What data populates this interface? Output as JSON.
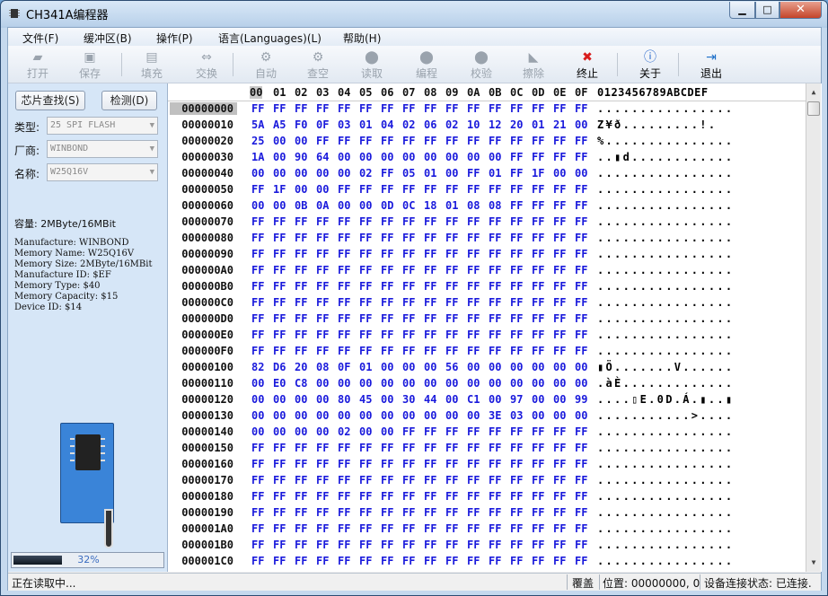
{
  "window": {
    "title": "CH341A编程器",
    "min": "▁",
    "max": "□",
    "close": "✕"
  },
  "menu": [
    "文件(F)",
    "缓冲区(B)",
    "操作(P)",
    "语言(Languages)(L)",
    "帮助(H)"
  ],
  "toolbar": [
    {
      "label": "打开",
      "icon": "folder-open-icon",
      "glyph": "▰",
      "enabled": false
    },
    {
      "label": "保存",
      "icon": "floppy-save-icon",
      "glyph": "▣",
      "enabled": false
    },
    {
      "label": "填充",
      "icon": "fill-icon",
      "glyph": "▤",
      "enabled": false
    },
    {
      "label": "交换",
      "icon": "swap-arrows-icon",
      "glyph": "⇔",
      "enabled": false
    },
    {
      "label": "自动",
      "icon": "auto-gear-icon",
      "glyph": "⚙",
      "enabled": false
    },
    {
      "label": "查空",
      "icon": "blank-check-icon",
      "glyph": "⚙",
      "enabled": false
    },
    {
      "label": "读取",
      "icon": "read-chip-icon",
      "glyph": "⬤",
      "enabled": false
    },
    {
      "label": "编程",
      "icon": "program-chip-icon",
      "glyph": "⬤",
      "enabled": false
    },
    {
      "label": "校验",
      "icon": "verify-chip-icon",
      "glyph": "⬤",
      "enabled": false
    },
    {
      "label": "擦除",
      "icon": "erase-icon",
      "glyph": "◣",
      "enabled": false
    },
    {
      "label": "终止",
      "icon": "stop-icon",
      "glyph": "✖",
      "enabled": true
    },
    {
      "label": "关于",
      "icon": "info-icon",
      "glyph": "ⓘ",
      "enabled": true
    },
    {
      "label": "退出",
      "icon": "exit-door-icon",
      "glyph": "⇥",
      "enabled": true
    }
  ],
  "panel": {
    "search_btn": "芯片查找(S)",
    "detect_btn": "检测(D)",
    "type_label": "类型:",
    "type_value": "25 SPI FLASH",
    "vendor_label": "厂商:",
    "vendor_value": "WINBOND",
    "name_label": "名称:",
    "name_value": "W25Q16V",
    "capacity": "容量: 2MByte/16MBit",
    "info_lines": [
      "Manufacture: WINBOND",
      "Memory Name: W25Q16V",
      "Memory Size: 2MByte/16MBit",
      "Manufacture ID: $EF",
      "Memory Type: $40",
      "Memory Capacity: $15",
      "Device ID: $14"
    ],
    "progress_text": "32%",
    "progress_value": 0.32
  },
  "hex": {
    "columns": [
      "00",
      "01",
      "02",
      "03",
      "04",
      "05",
      "06",
      "07",
      "08",
      "09",
      "0A",
      "0B",
      "0C",
      "0D",
      "0E",
      "0F"
    ],
    "ascii_header": "0123456789ABCDEF",
    "rows": [
      {
        "addr": "00000000",
        "bytes": [
          "FF",
          "FF",
          "FF",
          "FF",
          "FF",
          "FF",
          "FF",
          "FF",
          "FF",
          "FF",
          "FF",
          "FF",
          "FF",
          "FF",
          "FF",
          "FF"
        ],
        "ascii": "................"
      },
      {
        "addr": "00000010",
        "bytes": [
          "5A",
          "A5",
          "F0",
          "0F",
          "03",
          "01",
          "04",
          "02",
          "06",
          "02",
          "10",
          "12",
          "20",
          "01",
          "21",
          "00"
        ],
        "ascii": "Z¥ð.........!."
      },
      {
        "addr": "00000020",
        "bytes": [
          "25",
          "00",
          "00",
          "FF",
          "FF",
          "FF",
          "FF",
          "FF",
          "FF",
          "FF",
          "FF",
          "FF",
          "FF",
          "FF",
          "FF",
          "FF"
        ],
        "ascii": "%..............."
      },
      {
        "addr": "00000030",
        "bytes": [
          "1A",
          "00",
          "90",
          "64",
          "00",
          "00",
          "00",
          "00",
          "00",
          "00",
          "00",
          "00",
          "FF",
          "FF",
          "FF",
          "FF"
        ],
        "ascii": "..▮d............"
      },
      {
        "addr": "00000040",
        "bytes": [
          "00",
          "00",
          "00",
          "00",
          "00",
          "02",
          "FF",
          "05",
          "01",
          "00",
          "FF",
          "01",
          "FF",
          "1F",
          "00",
          "00"
        ],
        "ascii": "................"
      },
      {
        "addr": "00000050",
        "bytes": [
          "FF",
          "1F",
          "00",
          "00",
          "FF",
          "FF",
          "FF",
          "FF",
          "FF",
          "FF",
          "FF",
          "FF",
          "FF",
          "FF",
          "FF",
          "FF"
        ],
        "ascii": "................"
      },
      {
        "addr": "00000060",
        "bytes": [
          "00",
          "00",
          "0B",
          "0A",
          "00",
          "00",
          "0D",
          "0C",
          "18",
          "01",
          "08",
          "08",
          "FF",
          "FF",
          "FF",
          "FF"
        ],
        "ascii": "................"
      },
      {
        "addr": "00000070",
        "bytes": [
          "FF",
          "FF",
          "FF",
          "FF",
          "FF",
          "FF",
          "FF",
          "FF",
          "FF",
          "FF",
          "FF",
          "FF",
          "FF",
          "FF",
          "FF",
          "FF"
        ],
        "ascii": "................"
      },
      {
        "addr": "00000080",
        "bytes": [
          "FF",
          "FF",
          "FF",
          "FF",
          "FF",
          "FF",
          "FF",
          "FF",
          "FF",
          "FF",
          "FF",
          "FF",
          "FF",
          "FF",
          "FF",
          "FF"
        ],
        "ascii": "................"
      },
      {
        "addr": "00000090",
        "bytes": [
          "FF",
          "FF",
          "FF",
          "FF",
          "FF",
          "FF",
          "FF",
          "FF",
          "FF",
          "FF",
          "FF",
          "FF",
          "FF",
          "FF",
          "FF",
          "FF"
        ],
        "ascii": "................"
      },
      {
        "addr": "000000A0",
        "bytes": [
          "FF",
          "FF",
          "FF",
          "FF",
          "FF",
          "FF",
          "FF",
          "FF",
          "FF",
          "FF",
          "FF",
          "FF",
          "FF",
          "FF",
          "FF",
          "FF"
        ],
        "ascii": "................"
      },
      {
        "addr": "000000B0",
        "bytes": [
          "FF",
          "FF",
          "FF",
          "FF",
          "FF",
          "FF",
          "FF",
          "FF",
          "FF",
          "FF",
          "FF",
          "FF",
          "FF",
          "FF",
          "FF",
          "FF"
        ],
        "ascii": "................"
      },
      {
        "addr": "000000C0",
        "bytes": [
          "FF",
          "FF",
          "FF",
          "FF",
          "FF",
          "FF",
          "FF",
          "FF",
          "FF",
          "FF",
          "FF",
          "FF",
          "FF",
          "FF",
          "FF",
          "FF"
        ],
        "ascii": "................"
      },
      {
        "addr": "000000D0",
        "bytes": [
          "FF",
          "FF",
          "FF",
          "FF",
          "FF",
          "FF",
          "FF",
          "FF",
          "FF",
          "FF",
          "FF",
          "FF",
          "FF",
          "FF",
          "FF",
          "FF"
        ],
        "ascii": "................"
      },
      {
        "addr": "000000E0",
        "bytes": [
          "FF",
          "FF",
          "FF",
          "FF",
          "FF",
          "FF",
          "FF",
          "FF",
          "FF",
          "FF",
          "FF",
          "FF",
          "FF",
          "FF",
          "FF",
          "FF"
        ],
        "ascii": "................"
      },
      {
        "addr": "000000F0",
        "bytes": [
          "FF",
          "FF",
          "FF",
          "FF",
          "FF",
          "FF",
          "FF",
          "FF",
          "FF",
          "FF",
          "FF",
          "FF",
          "FF",
          "FF",
          "FF",
          "FF"
        ],
        "ascii": "................"
      },
      {
        "addr": "00000100",
        "bytes": [
          "82",
          "D6",
          "20",
          "08",
          "0F",
          "01",
          "00",
          "00",
          "00",
          "56",
          "00",
          "00",
          "00",
          "00",
          "00",
          "00"
        ],
        "ascii": "▮Ö.......V......"
      },
      {
        "addr": "00000110",
        "bytes": [
          "00",
          "E0",
          "C8",
          "00",
          "00",
          "00",
          "00",
          "00",
          "00",
          "00",
          "00",
          "00",
          "00",
          "00",
          "00",
          "00"
        ],
        "ascii": ".àÈ............."
      },
      {
        "addr": "00000120",
        "bytes": [
          "00",
          "00",
          "00",
          "00",
          "80",
          "45",
          "00",
          "30",
          "44",
          "00",
          "C1",
          "00",
          "97",
          "00",
          "00",
          "99"
        ],
        "ascii": "....▯E.0D.Á.▮..▮"
      },
      {
        "addr": "00000130",
        "bytes": [
          "00",
          "00",
          "00",
          "00",
          "00",
          "00",
          "00",
          "00",
          "00",
          "00",
          "00",
          "3E",
          "03",
          "00",
          "00",
          "00"
        ],
        "ascii": "...........>...."
      },
      {
        "addr": "00000140",
        "bytes": [
          "00",
          "00",
          "00",
          "00",
          "02",
          "00",
          "00",
          "FF",
          "FF",
          "FF",
          "FF",
          "FF",
          "FF",
          "FF",
          "FF",
          "FF"
        ],
        "ascii": "................"
      },
      {
        "addr": "00000150",
        "bytes": [
          "FF",
          "FF",
          "FF",
          "FF",
          "FF",
          "FF",
          "FF",
          "FF",
          "FF",
          "FF",
          "FF",
          "FF",
          "FF",
          "FF",
          "FF",
          "FF"
        ],
        "ascii": "................"
      },
      {
        "addr": "00000160",
        "bytes": [
          "FF",
          "FF",
          "FF",
          "FF",
          "FF",
          "FF",
          "FF",
          "FF",
          "FF",
          "FF",
          "FF",
          "FF",
          "FF",
          "FF",
          "FF",
          "FF"
        ],
        "ascii": "................"
      },
      {
        "addr": "00000170",
        "bytes": [
          "FF",
          "FF",
          "FF",
          "FF",
          "FF",
          "FF",
          "FF",
          "FF",
          "FF",
          "FF",
          "FF",
          "FF",
          "FF",
          "FF",
          "FF",
          "FF"
        ],
        "ascii": "................"
      },
      {
        "addr": "00000180",
        "bytes": [
          "FF",
          "FF",
          "FF",
          "FF",
          "FF",
          "FF",
          "FF",
          "FF",
          "FF",
          "FF",
          "FF",
          "FF",
          "FF",
          "FF",
          "FF",
          "FF"
        ],
        "ascii": "................"
      },
      {
        "addr": "00000190",
        "bytes": [
          "FF",
          "FF",
          "FF",
          "FF",
          "FF",
          "FF",
          "FF",
          "FF",
          "FF",
          "FF",
          "FF",
          "FF",
          "FF",
          "FF",
          "FF",
          "FF"
        ],
        "ascii": "................"
      },
      {
        "addr": "000001A0",
        "bytes": [
          "FF",
          "FF",
          "FF",
          "FF",
          "FF",
          "FF",
          "FF",
          "FF",
          "FF",
          "FF",
          "FF",
          "FF",
          "FF",
          "FF",
          "FF",
          "FF"
        ],
        "ascii": "................"
      },
      {
        "addr": "000001B0",
        "bytes": [
          "FF",
          "FF",
          "FF",
          "FF",
          "FF",
          "FF",
          "FF",
          "FF",
          "FF",
          "FF",
          "FF",
          "FF",
          "FF",
          "FF",
          "FF",
          "FF"
        ],
        "ascii": "................"
      },
      {
        "addr": "000001C0",
        "bytes": [
          "FF",
          "FF",
          "FF",
          "FF",
          "FF",
          "FF",
          "FF",
          "FF",
          "FF",
          "FF",
          "FF",
          "FF",
          "FF",
          "FF",
          "FF",
          "FF"
        ],
        "ascii": "................"
      }
    ]
  },
  "status": {
    "left": "正在读取中...",
    "mode": "覆盖",
    "position": "位置: 00000000, 0",
    "connection": "设备连接状态: 已连接."
  }
}
